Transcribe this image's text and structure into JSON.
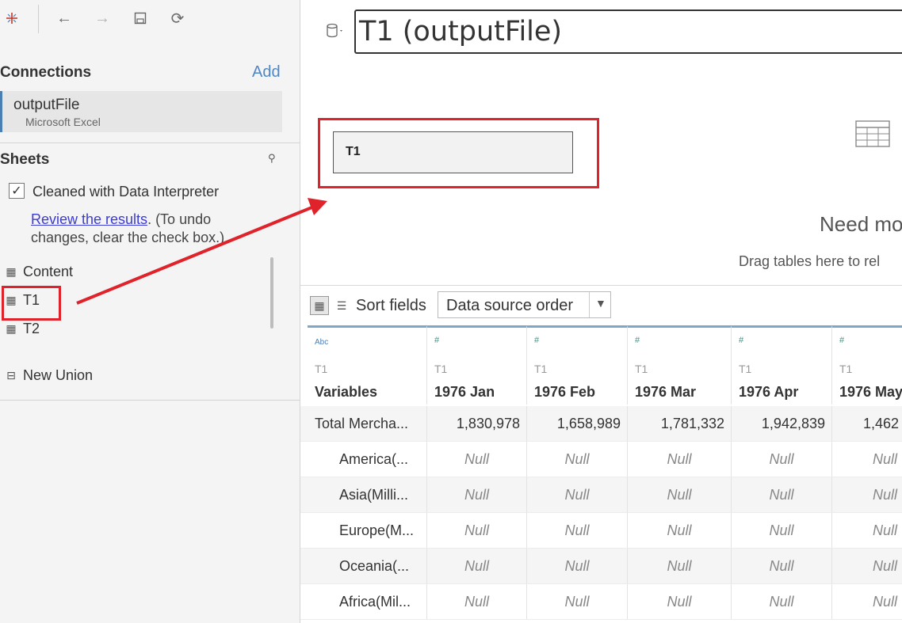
{
  "toolbar": {
    "icons": [
      "tableau-logo-icon",
      "back-arrow-icon",
      "forward-arrow-icon",
      "save-icon",
      "refresh-icon"
    ]
  },
  "connections": {
    "title": "Connections",
    "add_label": "Add",
    "item": {
      "name": "outputFile",
      "type": "Microsoft Excel"
    }
  },
  "sheets": {
    "title": "Sheets",
    "data_interpreter": {
      "checked": true,
      "label": "Cleaned with Data Interpreter",
      "review_link": "Review the results",
      "review_rest": ". (To undo changes, clear the check box.)"
    },
    "items": [
      {
        "label": "Content",
        "icon": "table-icon"
      },
      {
        "label": "T1",
        "icon": "table-icon"
      },
      {
        "label": "T2",
        "icon": "table-icon"
      }
    ],
    "new_union": "New Union"
  },
  "canvas": {
    "datasource_title": "T1 (outputFile)",
    "table_card": "T1",
    "need_more": "Need mo",
    "drag_hint": "Drag tables here to rel"
  },
  "grid": {
    "sort_label": "Sort fields",
    "sort_value": "Data source order",
    "columns": [
      {
        "type": "Abc",
        "source": "T1",
        "name": "Variables"
      },
      {
        "type": "#",
        "source": "T1",
        "name": "1976 Jan"
      },
      {
        "type": "#",
        "source": "T1",
        "name": "1976 Feb"
      },
      {
        "type": "#",
        "source": "T1",
        "name": "1976 Mar"
      },
      {
        "type": "#",
        "source": "T1",
        "name": "1976 Apr"
      },
      {
        "type": "#",
        "source": "T1",
        "name": "1976 May"
      }
    ],
    "rows": [
      {
        "label": "Total Mercha...",
        "values": [
          "1,830,978",
          "1,658,989",
          "1,781,332",
          "1,942,839",
          "1,462"
        ]
      },
      {
        "label": "America(...",
        "values": [
          "Null",
          "Null",
          "Null",
          "Null",
          "Null"
        ]
      },
      {
        "label": "Asia(Milli...",
        "values": [
          "Null",
          "Null",
          "Null",
          "Null",
          "Null"
        ]
      },
      {
        "label": "Europe(M...",
        "values": [
          "Null",
          "Null",
          "Null",
          "Null",
          "Null"
        ]
      },
      {
        "label": "Oceania(...",
        "values": [
          "Null",
          "Null",
          "Null",
          "Null",
          "Null"
        ]
      },
      {
        "label": "Africa(Mil...",
        "values": [
          "Null",
          "Null",
          "Null",
          "Null",
          "Null"
        ]
      }
    ]
  },
  "colors": {
    "highlight": "#e0222a",
    "accent": "#4f87c6",
    "header_border": "#7da7c9"
  }
}
